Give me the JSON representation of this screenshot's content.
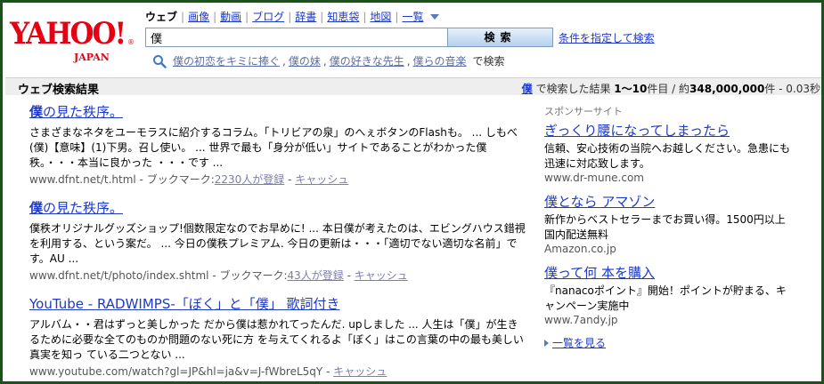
{
  "logo": {
    "main": "YAHOO!",
    "sub": "JAPAN",
    "reg": "®"
  },
  "tabs": [
    {
      "label": "ウェブ",
      "active": true
    },
    {
      "label": "画像"
    },
    {
      "label": "動画"
    },
    {
      "label": "ブログ"
    },
    {
      "label": "辞書"
    },
    {
      "label": "知恵袋"
    },
    {
      "label": "地図"
    },
    {
      "label": "一覧"
    }
  ],
  "search": {
    "value": "僕",
    "button": "検索",
    "advanced": "条件を指定して検索"
  },
  "suggest": {
    "items": [
      "僕の初恋をキミに捧ぐ",
      "僕の妹",
      "僕の好きな先生",
      "僕らの音楽"
    ],
    "tail": "で検索"
  },
  "bar": {
    "title": "ウェブ検索結果",
    "query": "僕",
    "pre": "で検索した結果",
    "range": "1〜10",
    "range_unit": "件目 / 約",
    "count": "348,000,000",
    "count_unit": "件 - 0.03秒"
  },
  "results": [
    {
      "title_b": "僕",
      "title": "の見た秩序。",
      "snippet": "さまざまなネタをユーモラスに紹介するコラム。「トリビアの泉」のへぇボタンのFlashも。 ... しもべ (僕)【意味】(1)下男。召し使い。 ... 世界で最も「身分が低い」サイトであることがわかった僕秩。・・・本当に良かった ・・・です ...",
      "url": "www.dfnt.net/t.html",
      "bookmark_label": "ブックマーク:",
      "bookmark": "2230人が登録",
      "cache": "キャッシュ"
    },
    {
      "title_b": "僕",
      "title": "の見た秩序。",
      "snippet": "僕秩オリジナルグッズショップ!個数限定なのでお早めに! ... 本日僕が考えたのは、エビングハウス錯視を利用する、という案だ。 ... 今日の僕秩プレミアム. 今日の更新は・・・「適切でない適切な名前」です。AU ...",
      "url": "www.dfnt.net/t/photo/index.shtml",
      "bookmark_label": "ブックマーク:",
      "bookmark": "43人が登録",
      "cache": "キャッシュ"
    },
    {
      "title_b": "",
      "title": "YouTube - RADWIMPS-「ぼく」と「僕」 歌詞付き",
      "snippet": "アルバム・・君はずっと美しかった だから僕は惹かれてったんだ. upしました ... 人生は「僕」が生きるために必要な全てのものか問題のない死に方 を与えてくれるよ「ぼく」はこの言葉の中の最も美しい真実を知っ ている二つとない ...",
      "url": "www.youtube.com/watch?gl=JP&hl=ja&v=J-fWbreL5qY",
      "bookmark_label": "",
      "bookmark": "",
      "cache": "キャッシュ"
    }
  ],
  "ads": {
    "sponsor": "スポンサーサイト",
    "items": [
      {
        "title": "ぎっくり腰になってしまったら",
        "text": "信頼、安心技術の当院へお越しください。急患にも迅速に対応致します。",
        "url": "www.dr-mune.com"
      },
      {
        "title": "僕となら アマゾン",
        "text": "新作からベストセラーまでお買い得。1500円以上国内配送無料",
        "url": "Amazon.co.jp"
      },
      {
        "title": "僕って何 本を購入",
        "text": "『nanacoポイント』開始！ポイントが貯まる、キャンペーン実施中",
        "url": "www.7andy.jp"
      }
    ],
    "more": "一覧を見る"
  }
}
